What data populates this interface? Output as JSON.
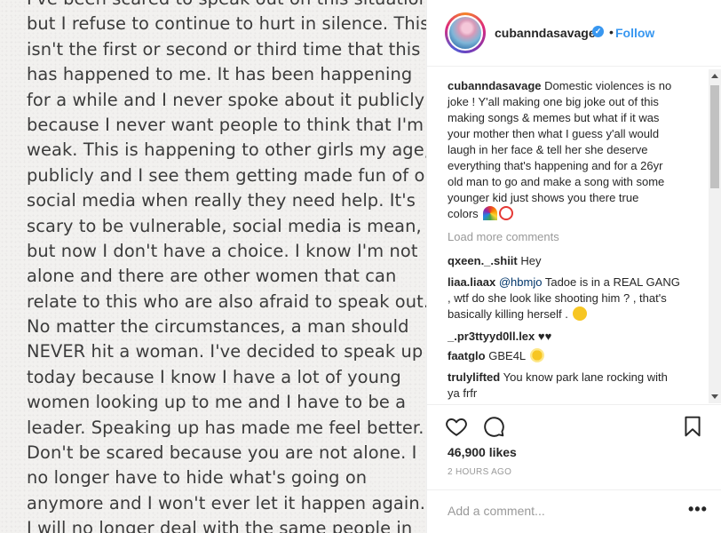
{
  "photo_text": [
    "I've been scared to speak out on this situation",
    "but I refuse to continue to hurt in silence. This",
    "isn't the first or second or third time that this",
    "has happened to me. It has been happening",
    "for a while and I never spoke about it publicly",
    "because I never want people to think that I'm",
    "weak. This is happening to other girls my age,",
    "publicly and I see them getting made fun of on",
    "social media when really they need help. It's",
    "scary to be vulnerable, social media is mean,",
    "but now I don't have a choice. I know I'm not",
    "alone and there are other women that can",
    "relate to this who are also afraid to speak out.",
    "No matter the circumstances, a man should",
    "NEVER hit a woman.  I've decided to speak up",
    "today because I know I have a lot of young",
    "women looking up to me and I have to be a",
    "leader. Speaking up has made me feel better.",
    "Don't be scared because you are not alone. I",
    "no longer have to hide what's going on",
    "anymore and I won't ever let it happen again.",
    "I will no longer deal with the same people in"
  ],
  "header": {
    "username": "cubanndasavage",
    "follow_label": "Follow",
    "separator": "•"
  },
  "caption": {
    "username": "cubanndasavage",
    "lines": [
      "Domestic violences is no",
      "joke ! Y'all making one big joke out of this",
      "making songs & memes but what if it was",
      "your mother then what I guess y'all would",
      "laugh in her face & tell her she deserve",
      "everything that's happening and for a 26yr",
      "old man to go and make a song with some",
      "younger kid just shows you there true",
      "colors"
    ]
  },
  "load_more_label": "Load more comments",
  "comments": [
    {
      "user": "qxeen._.shiit",
      "text": "Hey"
    },
    {
      "user": "liaa.liaax",
      "mention": "@hbmjo",
      "text": "Tadoe is in a REAL GANG",
      "text2": ", wtf do she look like shooting him ? , that's",
      "text3": "basically killing herself ."
    },
    {
      "user": "_.pr3ttyyd0ll.lex",
      "text": "♥♥"
    },
    {
      "user": "faatglo",
      "text": "GBE4L"
    },
    {
      "user": "trulylifted",
      "text": "You know park lane rocking with",
      "text2": "ya frfr"
    }
  ],
  "likes_label": "46,900 likes",
  "time_label": "2 HOURS AGO",
  "add_comment_placeholder": "Add a comment...",
  "more_label": "•••",
  "icons": {
    "like": "heart-outline-icon",
    "comment": "speech-bubble-icon",
    "save": "bookmark-icon",
    "verified": "verified-check-icon"
  },
  "colors": {
    "accent": "#3897f0",
    "text": "#262626",
    "muted": "#999999",
    "border": "#efefef"
  }
}
